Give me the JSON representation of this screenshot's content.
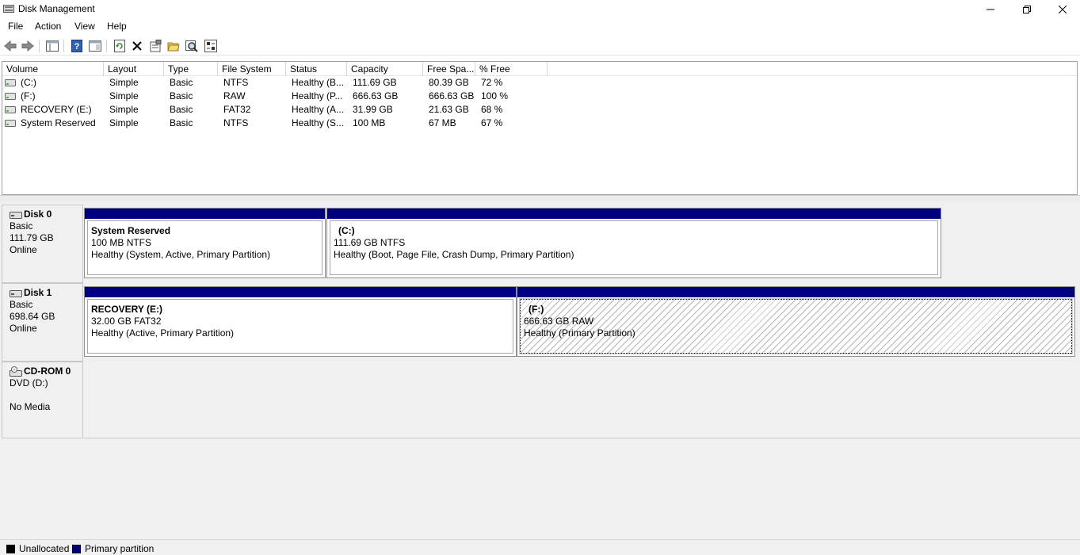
{
  "window": {
    "title": "Disk Management",
    "controls": {
      "minimize": "minimize",
      "maximize": "restore",
      "close": "close"
    }
  },
  "menu": [
    "File",
    "Action",
    "View",
    "Help"
  ],
  "toolbar": [
    "back-icon",
    "forward-icon",
    "console-tree-icon",
    "help-icon",
    "properties-pane-icon",
    "refresh-icon",
    "delete-icon",
    "properties-icon",
    "open-icon",
    "explore-icon",
    "settings-icon"
  ],
  "volume_list": {
    "columns": [
      "Volume",
      "Layout",
      "Type",
      "File System",
      "Status",
      "Capacity",
      "Free Spa...",
      "% Free"
    ],
    "rows": [
      {
        "volume": "(C:)",
        "layout": "Simple",
        "type": "Basic",
        "fs": "NTFS",
        "status": "Healthy (B...",
        "capacity": "111.69 GB",
        "free": "80.39 GB",
        "pct": "72 %"
      },
      {
        "volume": "(F:)",
        "layout": "Simple",
        "type": "Basic",
        "fs": "RAW",
        "status": "Healthy (P...",
        "capacity": "666.63 GB",
        "free": "666.63 GB",
        "pct": "100 %"
      },
      {
        "volume": "RECOVERY (E:)",
        "layout": "Simple",
        "type": "Basic",
        "fs": "FAT32",
        "status": "Healthy (A...",
        "capacity": "31.99 GB",
        "free": "21.63 GB",
        "pct": "68 %"
      },
      {
        "volume": "System Reserved",
        "layout": "Simple",
        "type": "Basic",
        "fs": "NTFS",
        "status": "Healthy (S...",
        "capacity": "100 MB",
        "free": "67 MB",
        "pct": "67 %"
      }
    ]
  },
  "disks": [
    {
      "name": "Disk 0",
      "type": "Basic",
      "size": "111.79 GB",
      "state": "Online",
      "partitions": [
        {
          "name": "System Reserved",
          "size": "100 MB NTFS",
          "status": "Healthy (System, Active, Primary Partition)"
        },
        {
          "name": "(C:)",
          "size": "111.69 GB NTFS",
          "status": "Healthy (Boot, Page File, Crash Dump, Primary Partition)"
        }
      ]
    },
    {
      "name": "Disk 1",
      "type": "Basic",
      "size": "698.64 GB",
      "state": "Online",
      "partitions": [
        {
          "name": "RECOVERY  (E:)",
          "size": "32.00 GB FAT32",
          "status": "Healthy (Active, Primary Partition)"
        },
        {
          "name": "(F:)",
          "size": "666.63 GB RAW",
          "status": "Healthy (Primary Partition)"
        }
      ]
    },
    {
      "name": "CD-ROM 0",
      "type": "DVD (D:)",
      "state": "No Media"
    }
  ],
  "legend": [
    {
      "label": "Unallocated",
      "color": "#000000"
    },
    {
      "label": "Primary partition",
      "color": "#00007f"
    }
  ],
  "colors": {
    "primary_partition_bar": "#00007f",
    "unallocated": "#000000"
  }
}
